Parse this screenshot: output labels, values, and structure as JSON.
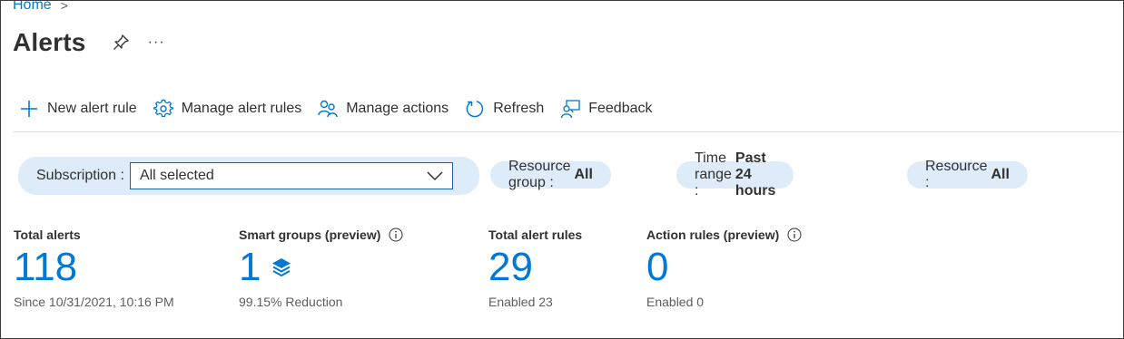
{
  "breadcrumb": {
    "home": "Home",
    "separator": ">"
  },
  "page": {
    "title": "Alerts",
    "more": "···"
  },
  "toolbar": {
    "items": [
      {
        "label": "New alert rule",
        "icon": "plus-icon"
      },
      {
        "label": "Manage alert rules",
        "icon": "gear-icon"
      },
      {
        "label": "Manage actions",
        "icon": "people-icon"
      },
      {
        "label": "Refresh",
        "icon": "refresh-icon"
      },
      {
        "label": "Feedback",
        "icon": "feedback-icon"
      }
    ]
  },
  "filters": {
    "subscription": {
      "label": "Subscription :",
      "value": "All selected"
    },
    "resource_group": {
      "label": "Resource group :",
      "value": "All"
    },
    "time_range": {
      "label": "Time range :",
      "value": "Past 24 hours"
    },
    "resource": {
      "label": "Resource :",
      "value": "All"
    }
  },
  "stats": [
    {
      "label": "Total alerts",
      "value": "118",
      "sub": "Since 10/31/2021, 10:16 PM"
    },
    {
      "label": "Smart groups (preview)",
      "value": "1",
      "sub": "99.15% Reduction"
    },
    {
      "label": "Total alert rules",
      "value": "29",
      "sub": "Enabled 23"
    },
    {
      "label": "Action rules (preview)",
      "value": "0",
      "sub": "Enabled 0"
    }
  ],
  "colors": {
    "accent": "#0078d4",
    "pill_bg": "#deecf9",
    "text": "#323130",
    "subtle": "#605e5c"
  }
}
